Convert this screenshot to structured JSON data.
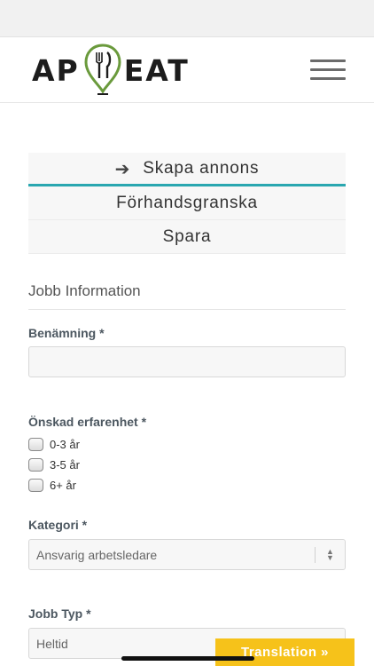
{
  "header": {
    "logo_left": "AP",
    "logo_right": "EAT",
    "logo_accent": "#6a9a3c"
  },
  "steps": [
    {
      "label": "Skapa annons",
      "active": true
    },
    {
      "label": "Förhandsgranska",
      "active": false
    },
    {
      "label": "Spara",
      "active": false
    }
  ],
  "section": {
    "title": "Jobb Information"
  },
  "form": {
    "benamning": {
      "label": "Benämning *",
      "value": ""
    },
    "erfarenhet": {
      "label": "Önskad erfarenhet *",
      "options": [
        "0-3 år",
        "3-5 år",
        "6+ år"
      ]
    },
    "kategori": {
      "label": "Kategori *",
      "selected": "Ansvarig arbetsledare"
    },
    "jobbtyp": {
      "label": "Jobb Typ *",
      "selected": "Heltid"
    }
  },
  "translation": {
    "label": "Translation »"
  },
  "colors": {
    "accent": "#2aa7b0",
    "translation_bg": "#f6c21a"
  }
}
